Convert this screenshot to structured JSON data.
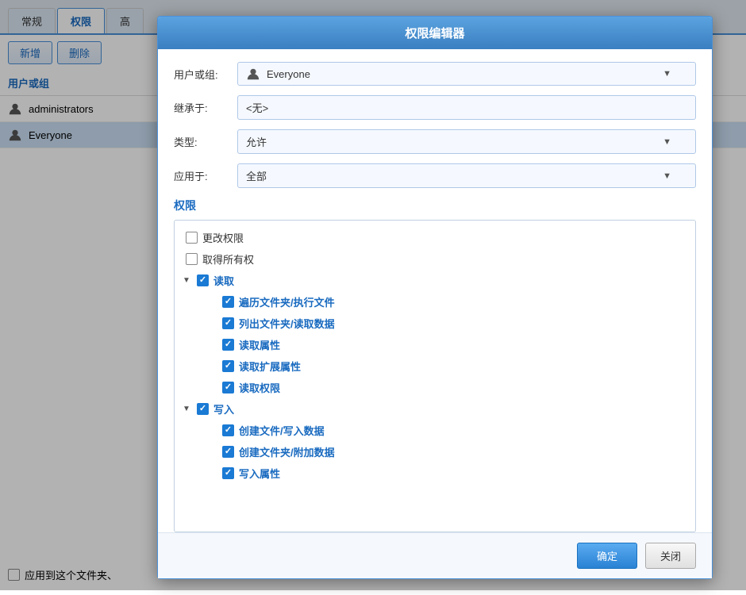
{
  "tabs": {
    "items": [
      {
        "label": "常规",
        "active": false
      },
      {
        "label": "权限",
        "active": true
      },
      {
        "label": "高",
        "active": false
      }
    ]
  },
  "toolbar": {
    "add_label": "新增",
    "delete_label": "删除"
  },
  "list": {
    "header": "用户或组",
    "items": [
      {
        "name": "administrators",
        "selected": false
      },
      {
        "name": "Everyone",
        "selected": true
      }
    ]
  },
  "apply_row": {
    "label": "应用到这个文件夹、"
  },
  "dialog": {
    "title": "权限编辑器",
    "fields": {
      "user_or_group_label": "用户或组:",
      "user_or_group_value": "Everyone",
      "inherit_label": "继承于:",
      "inherit_value": "<无>",
      "type_label": "类型:",
      "type_value": "允许",
      "apply_label": "应用于:",
      "apply_value": "全部"
    },
    "permissions": {
      "section_title": "权限",
      "items": [
        {
          "id": "change_perms",
          "label": "更改权限",
          "checked": false,
          "indent": 0,
          "is_group": false
        },
        {
          "id": "take_ownership",
          "label": "取得所有权",
          "checked": false,
          "indent": 0,
          "is_group": false
        },
        {
          "id": "read_group",
          "label": "读取",
          "checked": true,
          "indent": 0,
          "is_group": true,
          "expanded": true
        },
        {
          "id": "traverse",
          "label": "遍历文件夹/执行文件",
          "checked": true,
          "indent": 1,
          "is_group": false
        },
        {
          "id": "list_folder",
          "label": "列出文件夹/读取数据",
          "checked": true,
          "indent": 1,
          "is_group": false
        },
        {
          "id": "read_attrs",
          "label": "读取属性",
          "checked": true,
          "indent": 1,
          "is_group": false
        },
        {
          "id": "read_ext_attrs",
          "label": "读取扩展属性",
          "checked": true,
          "indent": 1,
          "is_group": false
        },
        {
          "id": "read_perms",
          "label": "读取权限",
          "checked": true,
          "indent": 1,
          "is_group": false
        },
        {
          "id": "write_group",
          "label": "写入",
          "checked": true,
          "indent": 0,
          "is_group": true,
          "expanded": true
        },
        {
          "id": "create_files",
          "label": "创建文件/写入数据",
          "checked": true,
          "indent": 1,
          "is_group": false
        },
        {
          "id": "create_folders",
          "label": "创建文件夹/附加数据",
          "checked": true,
          "indent": 1,
          "is_group": false
        },
        {
          "id": "write_attrs",
          "label": "写入属性",
          "checked": true,
          "indent": 1,
          "is_group": false
        }
      ]
    },
    "buttons": {
      "ok": "确定",
      "cancel": "关闭"
    }
  },
  "colors": {
    "accent": "#1a6bc0",
    "checked_bg": "#1a7ad4"
  }
}
